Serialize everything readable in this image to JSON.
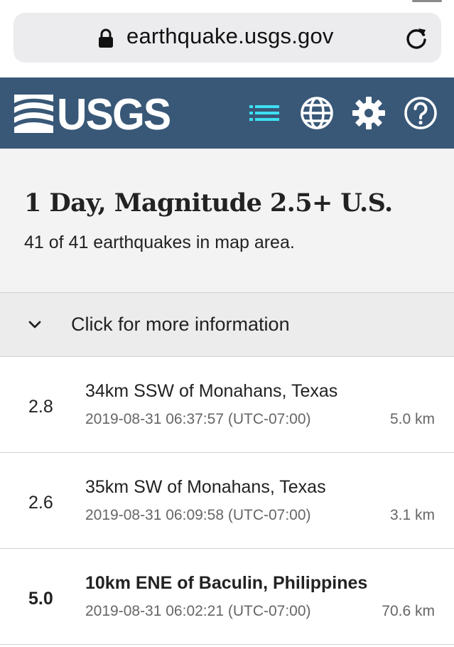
{
  "browser": {
    "url": "earthquake.usgs.gov",
    "icons": {
      "lock": "lock-icon",
      "reload": "reload-icon"
    }
  },
  "header": {
    "logo_text": "USGS",
    "icons": [
      "list-icon",
      "globe-icon",
      "gear-icon",
      "help-icon"
    ],
    "colors": {
      "background": "#395877",
      "active_icon": "#3ee0f4",
      "icon": "#ffffff"
    }
  },
  "summary": {
    "title": "1 Day, Magnitude 2.5+ U.S.",
    "count_text": "41 of 41 earthquakes in map area."
  },
  "more_info": {
    "label": "Click for more information",
    "icon": "chevron-down-icon"
  },
  "quakes": [
    {
      "mag": "2.8",
      "place": "34km SSW of Monahans, Texas",
      "time": "2019-08-31 06:37:57 (UTC-07:00)",
      "depth": "5.0 km"
    },
    {
      "mag": "2.6",
      "place": "35km SW of Monahans, Texas",
      "time": "2019-08-31 06:09:58 (UTC-07:00)",
      "depth": "3.1 km"
    },
    {
      "mag": "5.0",
      "place": "10km ENE of Baculin, Philippines",
      "time": "2019-08-31 06:02:21 (UTC-07:00)",
      "depth": "70.6 km"
    }
  ]
}
